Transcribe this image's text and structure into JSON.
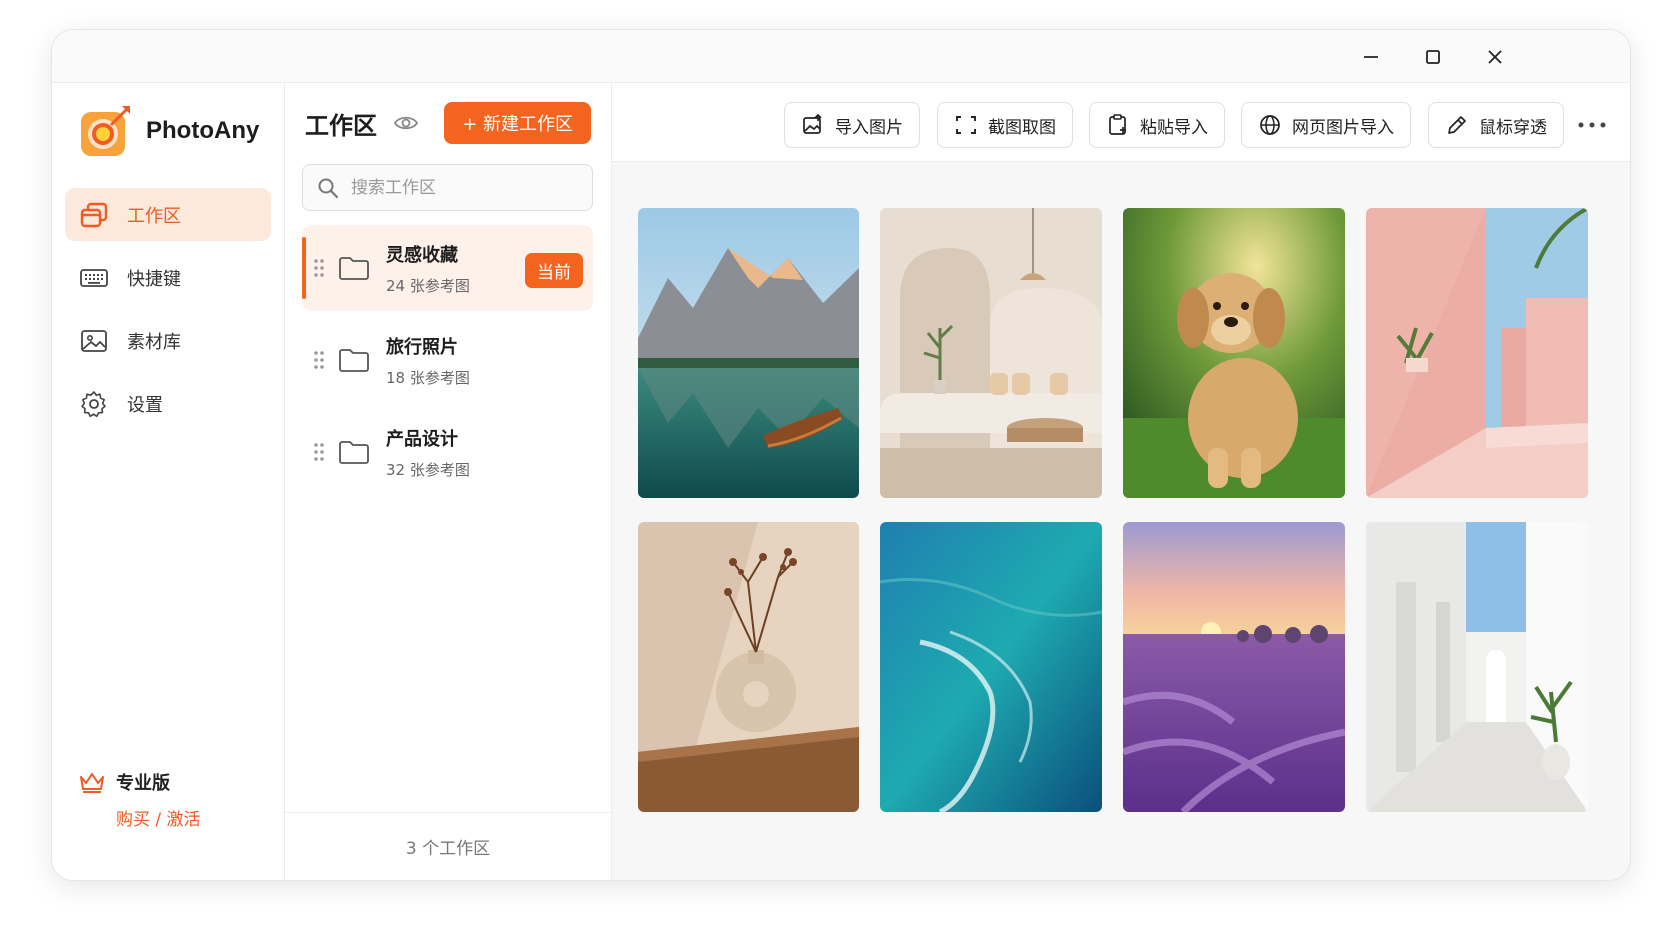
{
  "app": {
    "name": "PhotoAny",
    "colors": {
      "accent": "#f5641e",
      "accent_light": "#fde8dc",
      "text": "#1d1d1d"
    }
  },
  "window_controls": {
    "minimize_icon": "minimize-icon",
    "maximize_icon": "maximize-icon",
    "close_icon": "close-icon"
  },
  "sidebar": {
    "items": [
      {
        "label": "工作区",
        "icon": "workspace-icon",
        "active": true
      },
      {
        "label": "快捷键",
        "icon": "keyboard-icon",
        "active": false
      },
      {
        "label": "素材库",
        "icon": "image-library-icon",
        "active": false
      },
      {
        "label": "设置",
        "icon": "gear-icon",
        "active": false
      }
    ],
    "pro": {
      "title": "专业版",
      "buy": "购买",
      "separator": " / ",
      "activate": "激活"
    }
  },
  "workspace_panel": {
    "title": "工作区",
    "new_button": "+ 新建工作区",
    "search_placeholder": "搜索工作区",
    "items": [
      {
        "name": "灵感收藏",
        "count": "24 张参考图",
        "badge": "当前",
        "active": true
      },
      {
        "name": "旅行照片",
        "count": "18 张参考图",
        "active": false
      },
      {
        "name": "产品设计",
        "count": "32 张参考图",
        "active": false
      }
    ],
    "footer": "3 个工作区"
  },
  "toolbar": {
    "buttons": [
      {
        "label": "导入图片",
        "icon": "import-image-icon"
      },
      {
        "label": "截图取图",
        "icon": "screenshot-icon"
      },
      {
        "label": "粘贴导入",
        "icon": "paste-icon"
      },
      {
        "label": "网页图片导入",
        "icon": "globe-icon"
      },
      {
        "label": "鼠标穿透",
        "icon": "pen-icon"
      }
    ],
    "more_icon": "more-icon"
  },
  "images": [
    {
      "subject": "mountain-lake-boat"
    },
    {
      "subject": "minimal-interior"
    },
    {
      "subject": "golden-retriever-puppy"
    },
    {
      "subject": "pink-architecture"
    },
    {
      "subject": "vase-dried-flowers"
    },
    {
      "subject": "ocean-waves"
    },
    {
      "subject": "lavender-sunset"
    },
    {
      "subject": "white-corridor"
    }
  ]
}
